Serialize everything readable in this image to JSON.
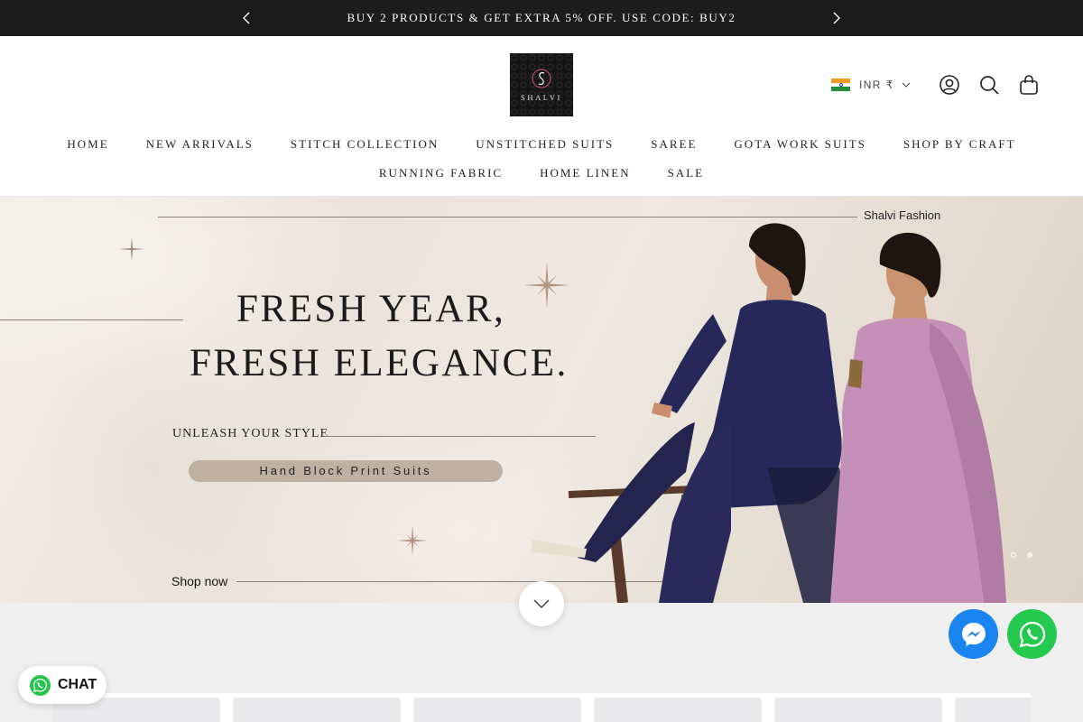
{
  "announcement": {
    "text": "BUY 2 PRODUCTS & GET EXTRA 5% OFF. USE CODE: BUY2",
    "prev_icon": "chevron-left-icon",
    "next_icon": "chevron-right-icon"
  },
  "header": {
    "logo_text": "SHALVI",
    "currency": "INR ₹",
    "icons": [
      "account-icon",
      "search-icon",
      "cart-icon"
    ]
  },
  "nav": {
    "row1": [
      "HOME",
      "NEW ARRIVALS",
      "STITCH COLLECTION",
      "UNSTITCHED SUITS",
      "SAREE",
      "GOTA WORK SUITS",
      "SHOP BY CRAFT"
    ],
    "row2": [
      "RUNNING FABRIC",
      "HOME LINEN",
      "SALE"
    ]
  },
  "hero": {
    "brand": "Shalvi Fashion",
    "headline_1": "FRESH YEAR,",
    "headline_2": "FRESH ELEGANCE.",
    "tagline": "UNLEASH YOUR STYLE",
    "pill": "Hand Block Print Suits",
    "cta": "Shop now",
    "slide_count": 2,
    "active_slide": 1
  },
  "floating": {
    "chat_label": "CHAT",
    "messenger_icon": "messenger-icon",
    "whatsapp_icon": "whatsapp-icon"
  },
  "colors": {
    "announcement_bg": "#1c1c1c",
    "messenger": "#1a84f0",
    "whatsapp": "#26c94f",
    "pill_bg": "#bfb0a2"
  }
}
